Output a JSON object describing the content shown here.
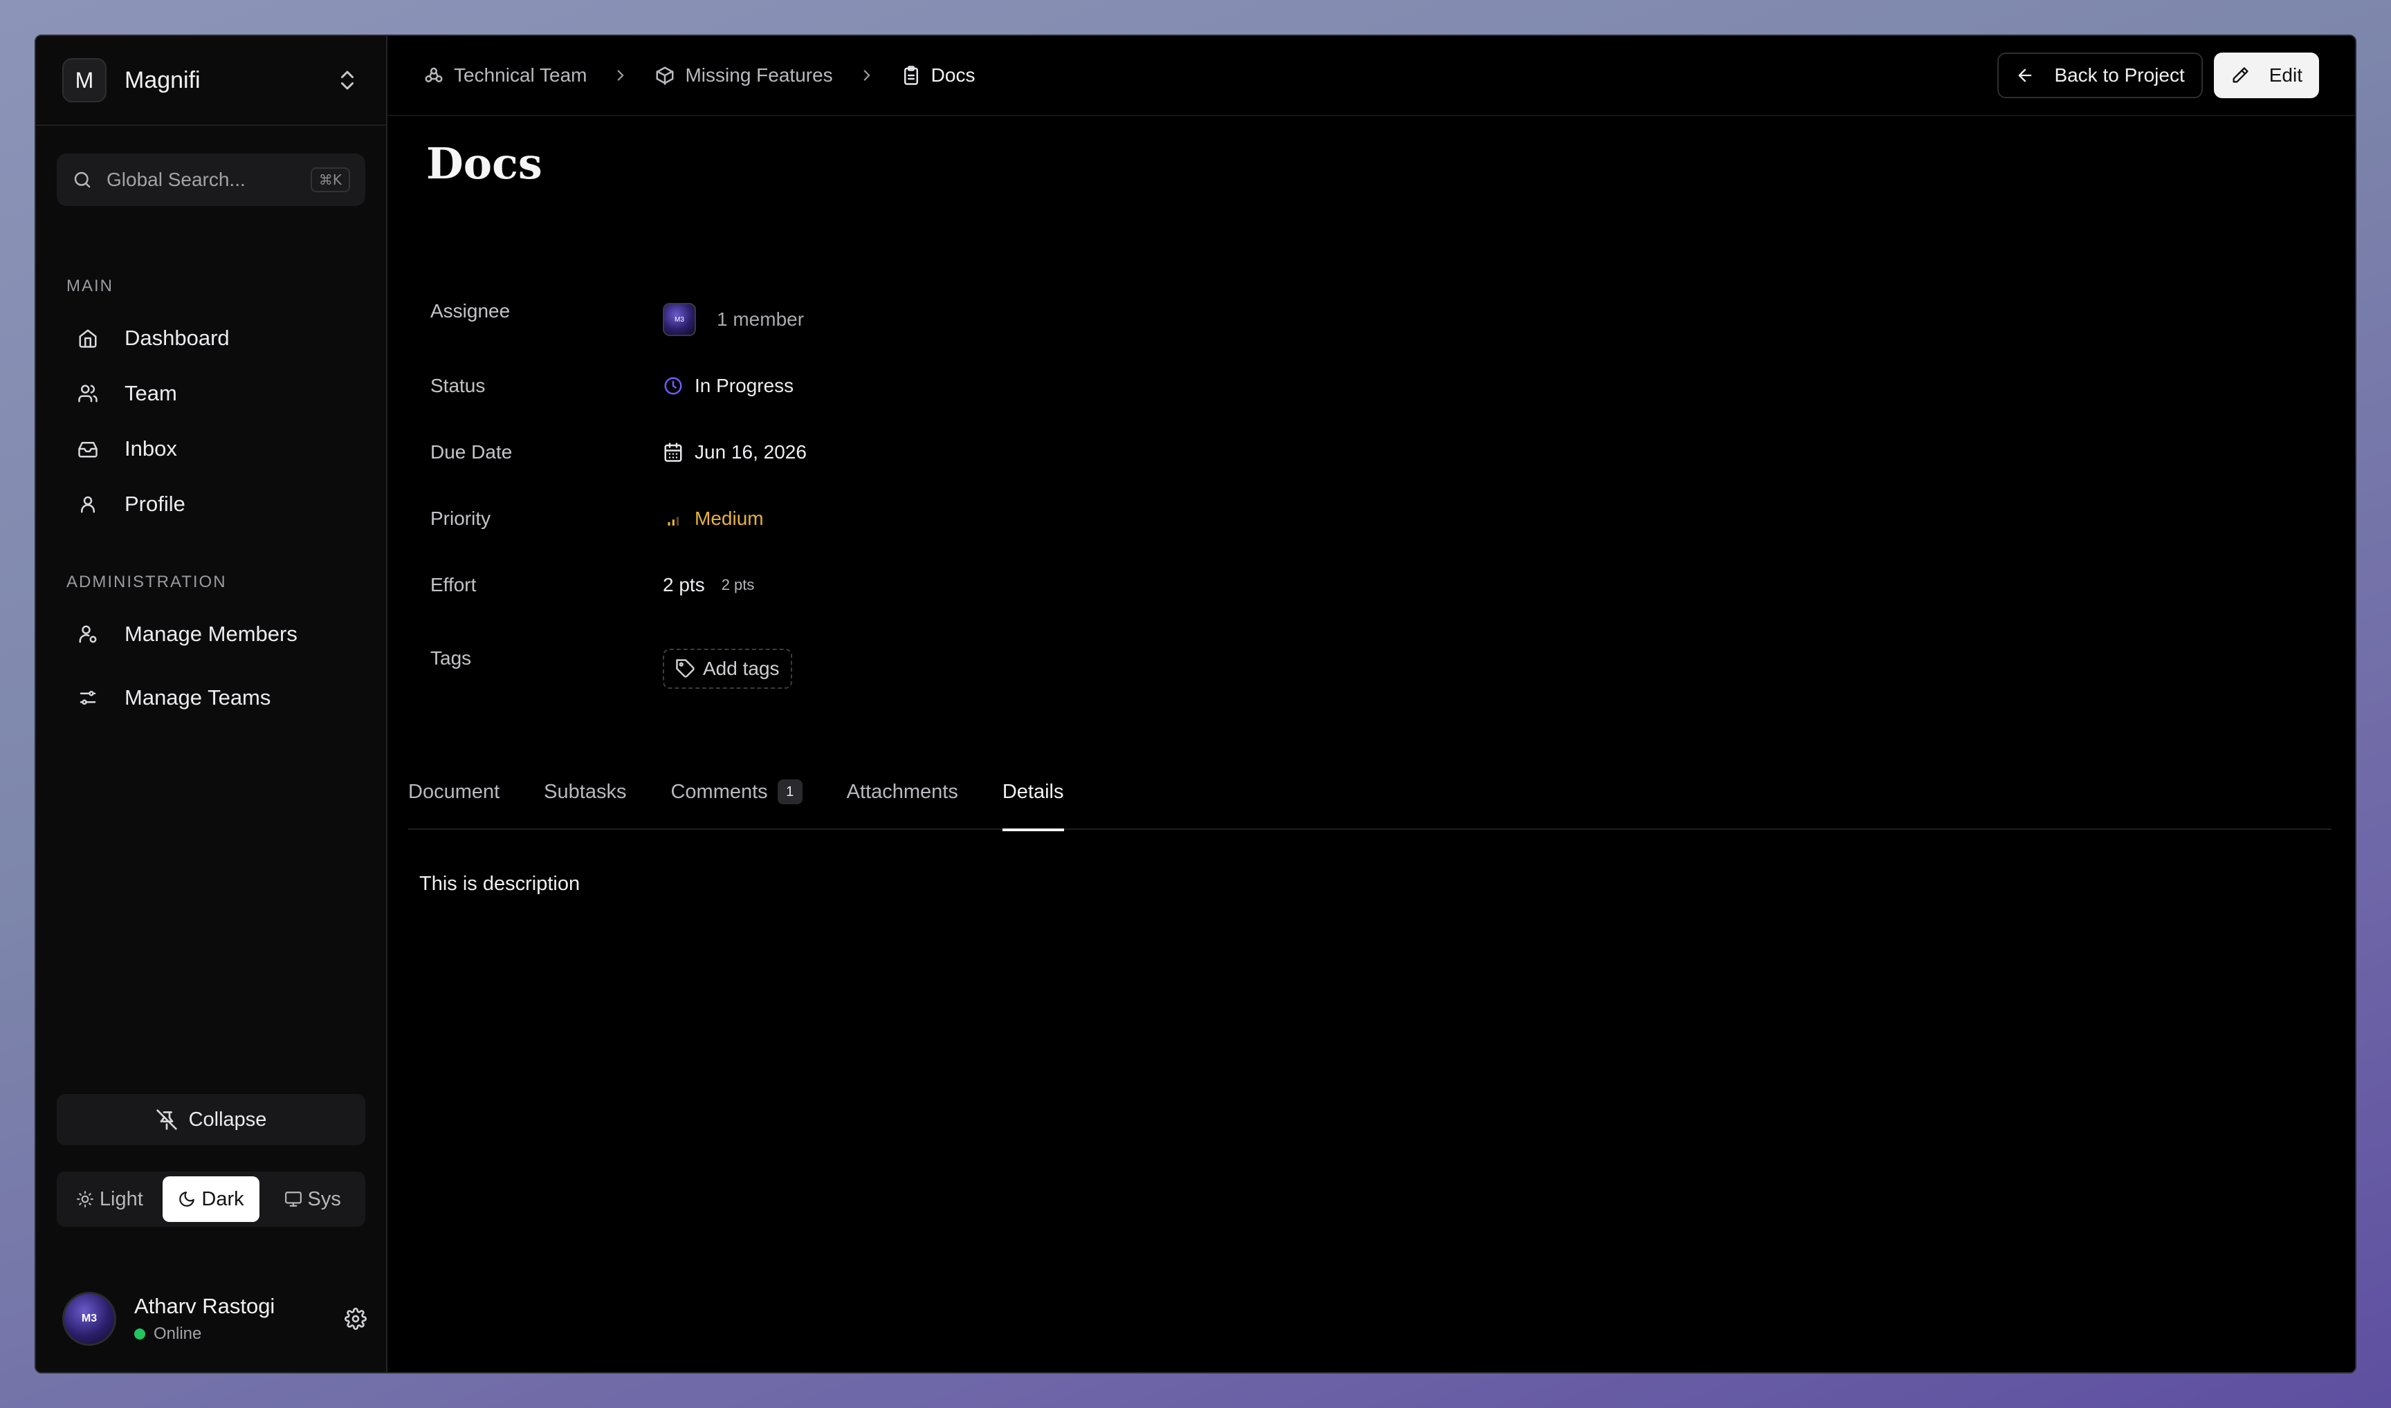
{
  "workspace": {
    "initial": "M",
    "name": "Magnifi"
  },
  "search": {
    "placeholder": "Global Search...",
    "shortcut": "⌘K"
  },
  "sidebar": {
    "main_label": "MAIN",
    "main_items": [
      {
        "label": "Dashboard",
        "icon": "home-icon"
      },
      {
        "label": "Team",
        "icon": "users-icon"
      },
      {
        "label": "Inbox",
        "icon": "inbox-icon"
      },
      {
        "label": "Profile",
        "icon": "user-icon"
      }
    ],
    "admin_label": "ADMINISTRATION",
    "admin_items": [
      {
        "label": "Manage Members",
        "icon": "user-cog-icon"
      },
      {
        "label": "Manage Teams",
        "icon": "sliders-icon"
      }
    ],
    "collapse_label": "Collapse",
    "theme": {
      "light": "Light",
      "dark": "Dark",
      "sys": "Sys",
      "selected": "Dark"
    }
  },
  "user": {
    "name": "Atharv Rastogi",
    "status": "Online",
    "avatar_text": "M3"
  },
  "breadcrumb": [
    {
      "label": "Technical Team",
      "icon": "team-icon"
    },
    {
      "label": "Missing Features",
      "icon": "box-icon"
    },
    {
      "label": "Docs",
      "icon": "clipboard-icon"
    }
  ],
  "actions": {
    "back": "Back to Project",
    "edit": "Edit"
  },
  "page": {
    "title": "Docs"
  },
  "properties": {
    "assignee": {
      "label": "Assignee",
      "value": "1 member",
      "avatar_text": "M3"
    },
    "status": {
      "label": "Status",
      "value": "In Progress",
      "color": "#6d5cf6"
    },
    "due_date": {
      "label": "Due Date",
      "value": "Jun 16, 2026"
    },
    "priority": {
      "label": "Priority",
      "value": "Medium",
      "color": "#e7b23a"
    },
    "effort": {
      "label": "Effort",
      "value": "2 pts",
      "secondary": "2 pts"
    },
    "tags": {
      "label": "Tags",
      "button": "Add tags"
    }
  },
  "tabs": [
    {
      "label": "Document"
    },
    {
      "label": "Subtasks"
    },
    {
      "label": "Comments",
      "badge": "1"
    },
    {
      "label": "Attachments"
    },
    {
      "label": "Details",
      "active": true
    }
  ],
  "content": {
    "description": "This is description"
  }
}
